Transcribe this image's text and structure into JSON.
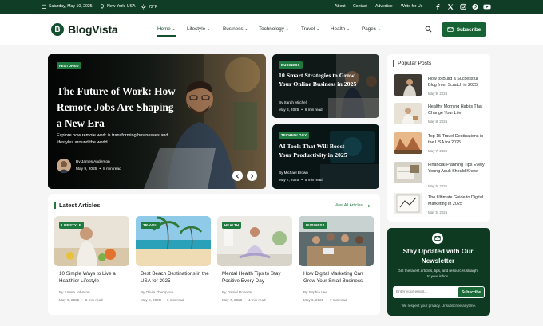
{
  "topbar": {
    "date": "Saturday, May 10, 2025",
    "location": "New York, USA",
    "weather": "72°F",
    "links": [
      "About",
      "Contact",
      "Advertise",
      "Write for Us"
    ]
  },
  "brand": {
    "logo_letter": "B",
    "name": "BlogVista",
    "accent": "#14502f"
  },
  "nav": {
    "items": [
      "Home",
      "Lifestyle",
      "Business",
      "Technology",
      "Travel",
      "Health",
      "Pages"
    ],
    "active": "Home",
    "subscribe_label": "Subscribe"
  },
  "hero": {
    "badge": "FEATURED",
    "title": "The Future of Work: How Remote Jobs Are Shaping a New Era",
    "excerpt": "Explore how remote work is transforming businesses and lifestyles around the world.",
    "author": "By James Anderson",
    "date": "May 9, 2025",
    "read": "8 min read"
  },
  "side_cards": [
    {
      "badge": "BUSINESS",
      "title": "10 Smart Strategies to Grow Your Online Business in 2025",
      "author": "By Sarah Mitchell",
      "date": "May 8, 2025",
      "read": "6 min read"
    },
    {
      "badge": "TECHNOLOGY",
      "title": "AI Tools That Will Boost Your Productivity in 2025",
      "author": "By Michael Brown",
      "date": "May 7, 2025",
      "read": "5 min read"
    }
  ],
  "latest": {
    "heading": "Latest Articles",
    "view_all": "View All Articles",
    "articles": [
      {
        "badge": "LIFESTYLE",
        "title": "10 Simple Ways to Live a Healthier Lifestyle",
        "author": "By Emma Johnson",
        "date": "May 9, 2025",
        "read": "5 min read"
      },
      {
        "badge": "TRAVEL",
        "title": "Best Beach Destinations in the USA for 2025",
        "author": "By Olivia Thompson",
        "date": "May 8, 2025",
        "read": "6 min read"
      },
      {
        "badge": "HEALTH",
        "title": "Mental Health Tips to Stay Positive Every Day",
        "author": "By Daniel Roberts",
        "date": "May 7, 2025",
        "read": "4 min read"
      },
      {
        "badge": "BUSINESS",
        "title": "How Digital Marketing Can Grow Your Small Business",
        "author": "By Sophia Lee",
        "date": "May 6, 2025",
        "read": "7 min read"
      }
    ]
  },
  "popular": {
    "heading": "Popular Posts",
    "posts": [
      {
        "title": "How to Build a Successful Blog from Scratch in 2025",
        "date": "May 9, 2025"
      },
      {
        "title": "Healthy Morning Habits That Change Your Life",
        "date": "May 8, 2025"
      },
      {
        "title": "Top 15 Travel Destinations in the USA for 2025",
        "date": "May 7, 2025"
      },
      {
        "title": "Financial Planning Tips Every Young Adult Should Know",
        "date": "May 6, 2025"
      },
      {
        "title": "The Ultimate Guide to Digital Marketing in 2025",
        "date": "May 5, 2025"
      }
    ]
  },
  "newsletter": {
    "title": "Stay Updated with Our Newsletter",
    "text": "Get the latest articles, tips, and resources straight to your inbox.",
    "placeholder": "Enter your email...",
    "button": "Subscribe",
    "privacy": "We respect your privacy. Unsubscribe anytime."
  }
}
